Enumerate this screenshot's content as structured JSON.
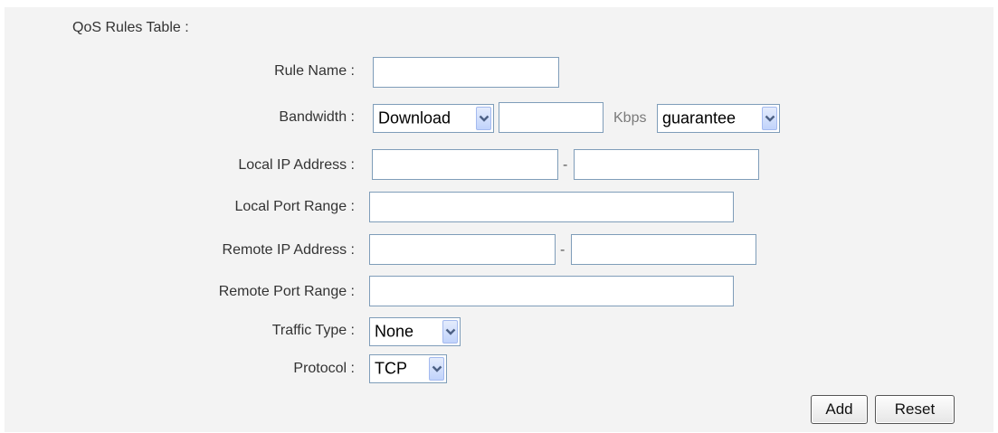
{
  "table_title": "QoS Rules Table :",
  "fields": {
    "rule_name": {
      "label": "Rule Name :",
      "value": ""
    },
    "bandwidth": {
      "label": "Bandwidth :",
      "direction": "Download",
      "rate_value": "",
      "unit": "Kbps",
      "mode": "guarantee"
    },
    "local_ip": {
      "label": "Local IP Address :",
      "start": "",
      "end": "",
      "separator": "-"
    },
    "local_port": {
      "label": "Local Port Range :",
      "value": ""
    },
    "remote_ip": {
      "label": "Remote IP Address :",
      "start": "",
      "end": "",
      "separator": "-"
    },
    "remote_port": {
      "label": "Remote Port Range :",
      "value": ""
    },
    "traffic_type": {
      "label": "Traffic Type :",
      "value": "None"
    },
    "protocol": {
      "label": "Protocol :",
      "value": "TCP"
    }
  },
  "buttons": {
    "add": "Add",
    "reset": "Reset"
  },
  "icons": {
    "dropdown": "chevron-down-icon"
  },
  "colors": {
    "panel_bg": "#f3f3f3",
    "input_border": "#7f9db9",
    "arrow_blue": "#4d6185"
  }
}
